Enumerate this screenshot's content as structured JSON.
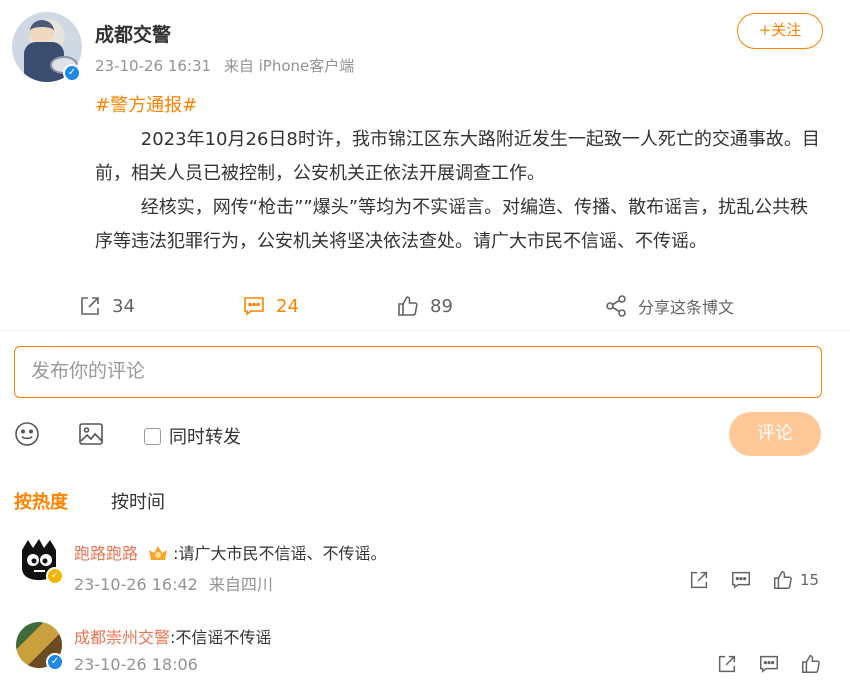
{
  "post": {
    "author": "成都交警",
    "time": "23-10-26 16:31",
    "source": "来自 iPhone客户端",
    "follow_label": "+关注",
    "hashtag": "#警方通报#",
    "paragraphs": [
      "        2023年10月26日8时许，我市锦江区东大路附近发生一起致一人死亡的交通事故。目前，相关人员已被控制，公安机关正依法开展调查工作。",
      "        经核实，网传“枪击””爆头”等均为不实谣言。对编造、传播、散布谣言，扰乱公共秩序等违法犯罪行为，公安机关将坚决依法查处。请广大市民不信谣、不传谣。"
    ],
    "share_count": "34",
    "comment_count": "24",
    "like_count": "89",
    "share_label": "分享这条博文"
  },
  "composer": {
    "placeholder": "发布你的评论",
    "repost_label": "同时转发",
    "submit_label": "评论"
  },
  "sort": {
    "hot_label": "按热度",
    "time_label": "按时间"
  },
  "comments": [
    {
      "name": "跑路跑路",
      "text": ":请广大市民不信谣、不传谣。",
      "time": "23-10-26 16:42",
      "location": "来自四川",
      "like_count": "15"
    },
    {
      "name": "成都崇州交警",
      "text": ":不信谣不传谣",
      "time": "23-10-26 18:06",
      "location": "",
      "like_count": ""
    }
  ],
  "colors": {
    "accent": "#ff8200",
    "verified": "#1e8ae5",
    "comment_name": "#eb7350",
    "muted": "#939393"
  }
}
